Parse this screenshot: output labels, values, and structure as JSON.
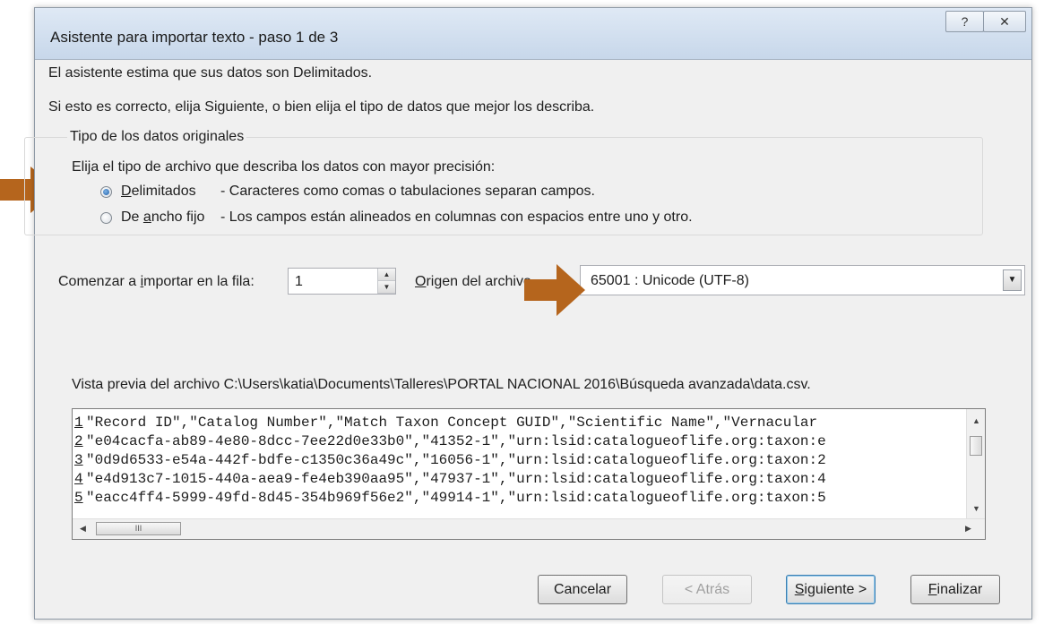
{
  "dialog": {
    "title": "Asistente para importar texto - paso 1 de 3",
    "help_glyph": "?",
    "close_glyph": "✕"
  },
  "intro": {
    "line1": "El asistente estima que sus datos son Delimitados.",
    "line2": "Si esto es correcto, elija Siguiente, o bien elija el tipo de datos que mejor los describa."
  },
  "data_type": {
    "legend": "Tipo de los datos originales",
    "prompt": "Elija el tipo de archivo que describa los datos con mayor precisión:",
    "options": [
      {
        "label_pre": "",
        "label_key": "D",
        "label_post": "elimitados",
        "desc": "- Caracteres como comas o tabulaciones separan campos.",
        "selected": true
      },
      {
        "label_pre": "De ",
        "label_key": "a",
        "label_post": "ncho fijo",
        "desc": "- Los campos están alineados en columnas con espacios entre uno y otro.",
        "selected": false
      }
    ]
  },
  "start_row": {
    "label_pre": "Comenzar a ",
    "label_key": "i",
    "label_post": "mportar en la fila:",
    "value": "1"
  },
  "origin": {
    "label_key": "O",
    "label_post": "rigen del archivo",
    "value": "65001 : Unicode (UTF-8)"
  },
  "preview": {
    "caption": "Vista previa del archivo C:\\Users\\katia\\Documents\\Talleres\\PORTAL NACIONAL 2016\\Búsqueda avanzada\\data.csv.",
    "lines": [
      {
        "num": "1",
        "text": "\"Record ID\",\"Catalog Number\",\"Match Taxon Concept GUID\",\"Scientific Name\",\"Vernacular"
      },
      {
        "num": "2",
        "text": "\"e04cacfa-ab89-4e80-8dcc-7ee22d0e33b0\",\"41352-1\",\"urn:lsid:catalogueoflife.org:taxon:e"
      },
      {
        "num": "3",
        "text": "\"0d9d6533-e54a-442f-bdfe-c1350c36a49c\",\"16056-1\",\"urn:lsid:catalogueoflife.org:taxon:2"
      },
      {
        "num": "4",
        "text": "\"e4d913c7-1015-440a-aea9-fe4eb390aa95\",\"47937-1\",\"urn:lsid:catalogueoflife.org:taxon:4"
      },
      {
        "num": "5",
        "text": "\"eacc4ff4-5999-49fd-8d45-354b969f56e2\",\"49914-1\",\"urn:lsid:catalogueoflife.org:taxon:5"
      }
    ],
    "hthumb_glyph": "III"
  },
  "buttons": {
    "cancel": "Cancelar",
    "back": "< Atrás",
    "next_key": "S",
    "next_post": "iguiente >",
    "finish_key": "F",
    "finish_post": "inalizar"
  },
  "colors": {
    "annotation_arrow": "#b5651d"
  }
}
